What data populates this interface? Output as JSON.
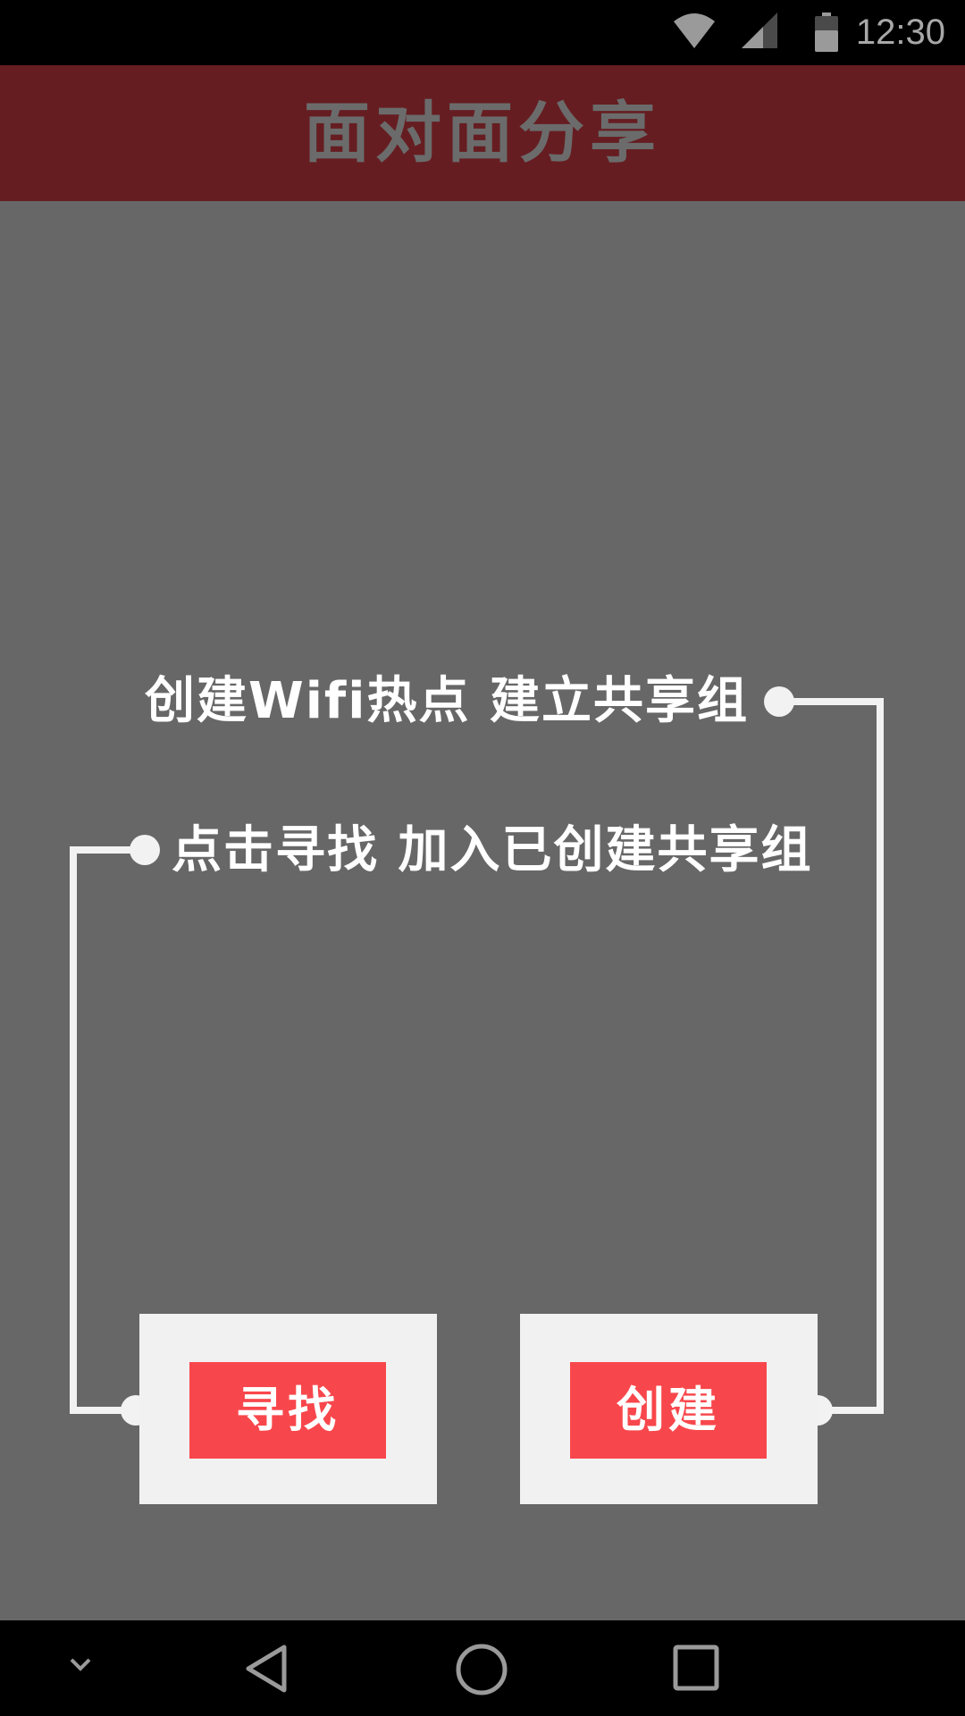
{
  "status_bar": {
    "time": "12:30",
    "icons": [
      "wifi-icon",
      "cell-signal-icon",
      "battery-icon"
    ]
  },
  "header": {
    "title": "面对面分享"
  },
  "instructions": {
    "create_text": "创建Wifi热点 建立共享组",
    "find_text": "点击寻找 加入已创建共享组"
  },
  "buttons": {
    "find_label": "寻找",
    "create_label": "创建"
  },
  "navigation_bar": {
    "icons": [
      "collapse-chevron-icon",
      "back-icon",
      "home-icon",
      "recents-icon"
    ]
  },
  "colors": {
    "background": "#676767",
    "title_bar": "#661d21",
    "title_text": "#6b6b6b",
    "button": "#f8474c",
    "card": "#f2f1f2",
    "line": "#f2f2f2"
  }
}
